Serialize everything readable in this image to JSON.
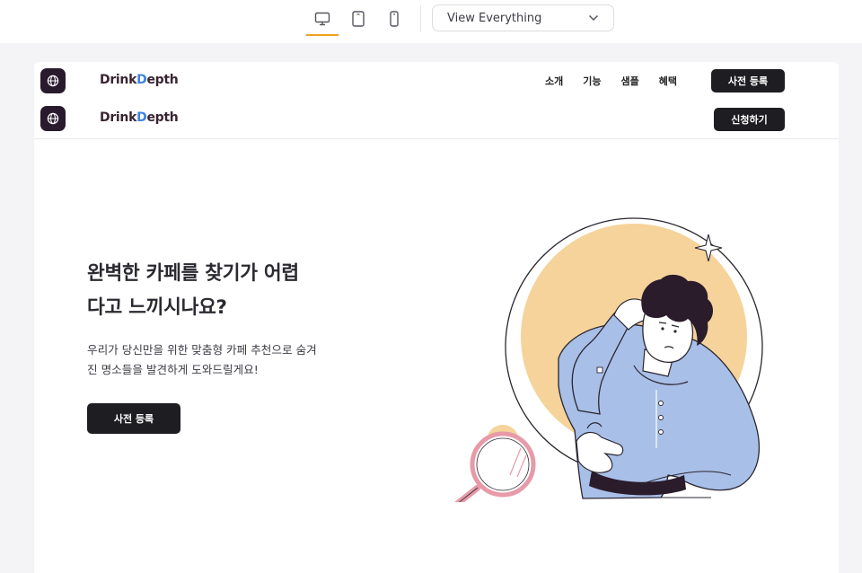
{
  "toolbar": {
    "devices": [
      "desktop-icon",
      "tablet-icon",
      "mobile-icon"
    ],
    "active_device": "desktop",
    "view_select_value": "View Everything",
    "accent": "#f0a01e"
  },
  "nav_desktop": {
    "logo_part1": "Drink",
    "logo_part2": "D",
    "logo_part3": "epth",
    "menu": [
      "소개",
      "기능",
      "샘플",
      "혜택"
    ],
    "cta": "사전 등록"
  },
  "nav_mobile": {
    "logo_part1": "Drink",
    "logo_part2": "D",
    "logo_part3": "epth",
    "cta": "신청하기"
  },
  "hero": {
    "title_line1": "완벽한 카페를 찾기가 어렵",
    "title_line2": "다고 느끼시나요?",
    "desc_line1": "우리가 당신만을 위한 맞춤형 카페 추천으로 숨겨",
    "desc_line2": "진 명소들을 발견하게 도와드릴게요!",
    "cta": "사전 등록"
  },
  "colors": {
    "dark": "#1e1e22",
    "logo_blue": "#3b82e6",
    "illustration_yellow": "#f5d39a",
    "illustration_blue": "#a8bfe8",
    "magnifier_pink": "#e79aa8"
  }
}
